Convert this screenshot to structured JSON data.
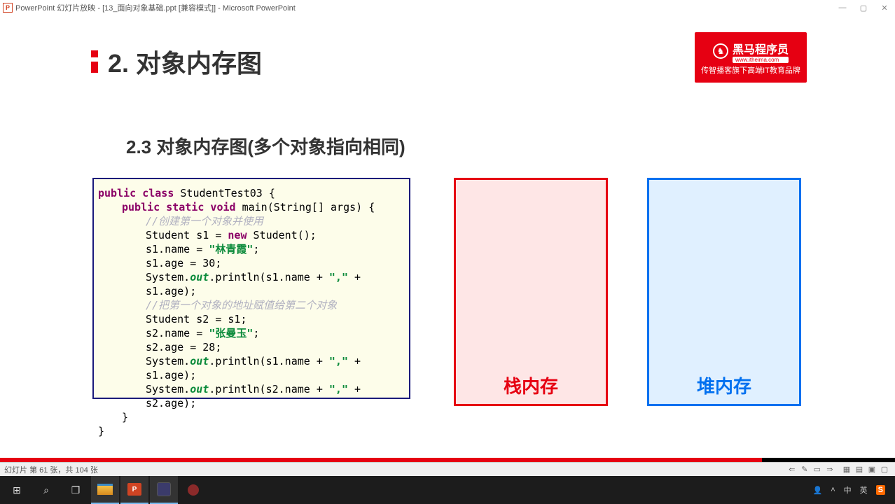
{
  "window": {
    "app_icon": "P",
    "title": "PowerPoint 幻灯片放映 - [13_面向对象基础.ppt [兼容模式]] - Microsoft PowerPoint"
  },
  "slide": {
    "chapter": "2. 对象内存图",
    "section": "2.3 对象内存图(多个对象指向相同)",
    "logo": {
      "brand": "黑马程序员",
      "site": "www.itheima.com",
      "tagline": "传智播客旗下高端IT教育品牌"
    },
    "stack_label": "栈内存",
    "heap_label": "堆内存",
    "code_plain": "public class StudentTest03 {\n    public static void main(String[] args) {\n        //创建第一个对象并使用\n        Student s1 = new Student();\n        s1.name = \"林青霞\";\n        s1.age = 30;\n        System.out.println(s1.name + \",\" + s1.age);\n        //把第一个对象的地址赋值给第二个对象\n        Student s2 = s1;\n        s2.name = \"张曼玉\";\n        s2.age = 28;\n        System.out.println(s1.name + \",\" + s1.age);\n        System.out.println(s2.name + \",\" + s2.age);\n    }\n}",
    "code": {
      "l1_a": "public class ",
      "l1_b": "StudentTest03 {",
      "l2_a": "public static void ",
      "l2_b": "main(String[] args) {",
      "l3": "//创建第一个对象并使用",
      "l4_a": "Student s1 = ",
      "l4_b": "new ",
      "l4_c": "Student();",
      "l5_a": "s1.name = ",
      "l5_b": "\"林青霞\"",
      "l5_c": ";",
      "l6": "s1.age = 30;",
      "l7_a": "System.",
      "l7_b": "out",
      "l7_c": ".println(s1.name + ",
      "l7_d": "\",\"",
      "l7_e": " + s1.age);",
      "l8": "//把第一个对象的地址赋值给第二个对象",
      "l9": "Student s2 = s1;",
      "l10_a": "s2.name = ",
      "l10_b": "\"张曼玉\"",
      "l10_c": ";",
      "l11": "s2.age = 28;",
      "l12_a": "System.",
      "l12_b": "out",
      "l12_c": ".println(s1.name + ",
      "l12_d": "\",\"",
      "l12_e": " + s1.age);",
      "l13_a": "System.",
      "l13_b": "out",
      "l13_c": ".println(s2.name + ",
      "l13_d": "\",\"",
      "l13_e": " + s2.age);",
      "l14": "}",
      "l15": "}"
    }
  },
  "status": {
    "slide_info": "幻灯片 第 61 张，共 104 张"
  },
  "taskbar": {
    "tray_lang": "英",
    "tray_ime": "中"
  }
}
